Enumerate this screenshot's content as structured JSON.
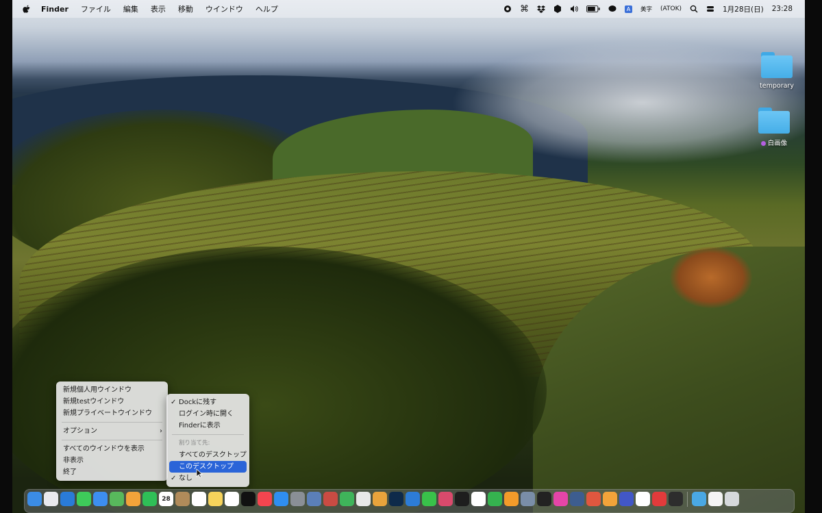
{
  "menubar": {
    "apple": "",
    "app_name": "Finder",
    "menus": [
      "ファイル",
      "編集",
      "表示",
      "移動",
      "ウインドウ",
      "ヘルプ"
    ],
    "status": {
      "ime_label": "美字",
      "atok_label": "(ATOK)",
      "date": "1月28日(日)",
      "time": "23:28"
    }
  },
  "desktop": {
    "items": [
      {
        "label": "temporary",
        "icon": "folder-icon"
      },
      {
        "label": "白画像",
        "icon": "folder-icon",
        "tag_color": "#b45fe0"
      }
    ]
  },
  "context_menu": {
    "items": [
      {
        "label": "新規個人用ウインドウ"
      },
      {
        "label": "新規testウインドウ"
      },
      {
        "label": "新規プライベートウインドウ"
      },
      {
        "label": "オプション",
        "submenu": true
      },
      {
        "label": "すべてのウインドウを表示"
      },
      {
        "label": "非表示"
      },
      {
        "label": "終了"
      }
    ]
  },
  "options_submenu": {
    "items": [
      {
        "label": "Dockに残す",
        "checked": true
      },
      {
        "label": "ログイン時に開く"
      },
      {
        "label": "Finderに表示"
      },
      {
        "label": "割り当て先:",
        "disabled": true
      },
      {
        "label": "すべてのデスクトップ"
      },
      {
        "label": "このデスクトップ",
        "highlighted": true
      },
      {
        "label": "なし",
        "checked": true
      }
    ]
  },
  "dock": {
    "calendar_day": "28",
    "apps": [
      "finder-icon",
      "launchpad-icon",
      "safari-icon",
      "messages-icon",
      "mail-icon",
      "maps-icon",
      "photos-icon",
      "facetime-icon",
      "calendar-icon",
      "contacts-icon",
      "reminders-icon",
      "notes-icon",
      "freeform-icon",
      "appletv-icon",
      "music-icon",
      "appstore-icon",
      "system-settings-icon",
      "preview-icon",
      "migration-icon",
      "numbers-icon",
      "chrome-icon",
      "firefox-icon",
      "photoshop-icon",
      "xcode-icon",
      "line-icon",
      "affinity-icon",
      "chatgpt-icon",
      "maps2-icon",
      "numbers2-icon",
      "pages-icon",
      "screens-icon",
      "quicktime-icon",
      "music2-icon",
      "activity-icon",
      "grid-icon",
      "slack-icon",
      "keynote-icon",
      "obsidian-icon",
      "creative-icon",
      "quick-icon"
    ],
    "tray": [
      "downloads-folder-icon",
      "white-window-icon",
      "trash-icon"
    ],
    "colors": {
      "finder-icon": "#3b8ce6",
      "launchpad-icon": "#e9e9ee",
      "safari-icon": "#2a7bd8",
      "messages-icon": "#3ecb5a",
      "mail-icon": "#3d8ef0",
      "maps-icon": "#58b85c",
      "photos-icon": "#f2a33a",
      "facetime-icon": "#2fbf57",
      "calendar-icon": "#ffffff",
      "contacts-icon": "#b08b5a",
      "reminders-icon": "#ffffff",
      "notes-icon": "#f6d35b",
      "freeform-icon": "#ffffff",
      "appletv-icon": "#111111",
      "music-icon": "#f4454f",
      "appstore-icon": "#2f8ef0",
      "system-settings-icon": "#8a8f96",
      "preview-icon": "#5b7fb8",
      "migration-icon": "#c94b43",
      "numbers-icon": "#3fb45a",
      "chrome-icon": "#e8e8e8",
      "firefox-icon": "#e8a33c",
      "photoshop-icon": "#0e2a4a",
      "xcode-icon": "#2d7cd6",
      "line-icon": "#39c14a",
      "affinity-icon": "#d94a6c",
      "chatgpt-icon": "#1e1e1e",
      "maps2-icon": "#ffffff",
      "numbers2-icon": "#35b34f",
      "pages-icon": "#f39b2a",
      "screens-icon": "#7a8ea8",
      "quicktime-icon": "#222222",
      "music2-icon": "#e545a8",
      "activity-icon": "#3d5d8f",
      "grid-icon": "#e0573f",
      "slack-icon": "#f2a33a",
      "keynote-icon": "#4257c7",
      "obsidian-icon": "#ffffff",
      "creative-icon": "#e23b3b",
      "quick-icon": "#2d2d2d"
    }
  }
}
